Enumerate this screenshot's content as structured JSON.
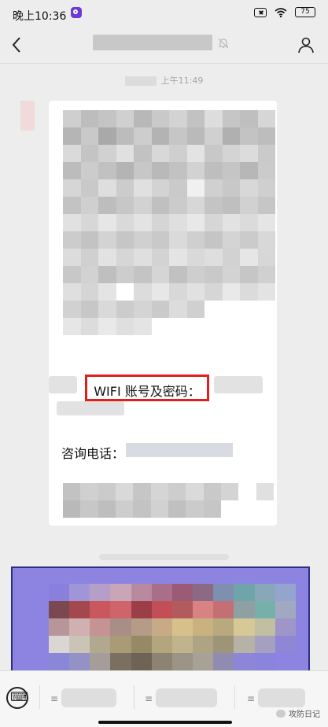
{
  "status_bar": {
    "time": "晚上10:36",
    "battery": "75"
  },
  "header": {
    "back_icon": "chevron-left-icon",
    "mute_icon": "bell-off-icon",
    "profile_icon": "person-icon"
  },
  "timestamp": "上午11:49",
  "message": {
    "wifi_label": "WIFI 账号及密码：",
    "phone_label": "咨询电话："
  },
  "bottom_bar": {
    "brand": "攻防日记"
  },
  "colors": {
    "highlight_box": "#e0201a",
    "image_border": "#2e2f83",
    "image_bg": "#8d84e2"
  }
}
